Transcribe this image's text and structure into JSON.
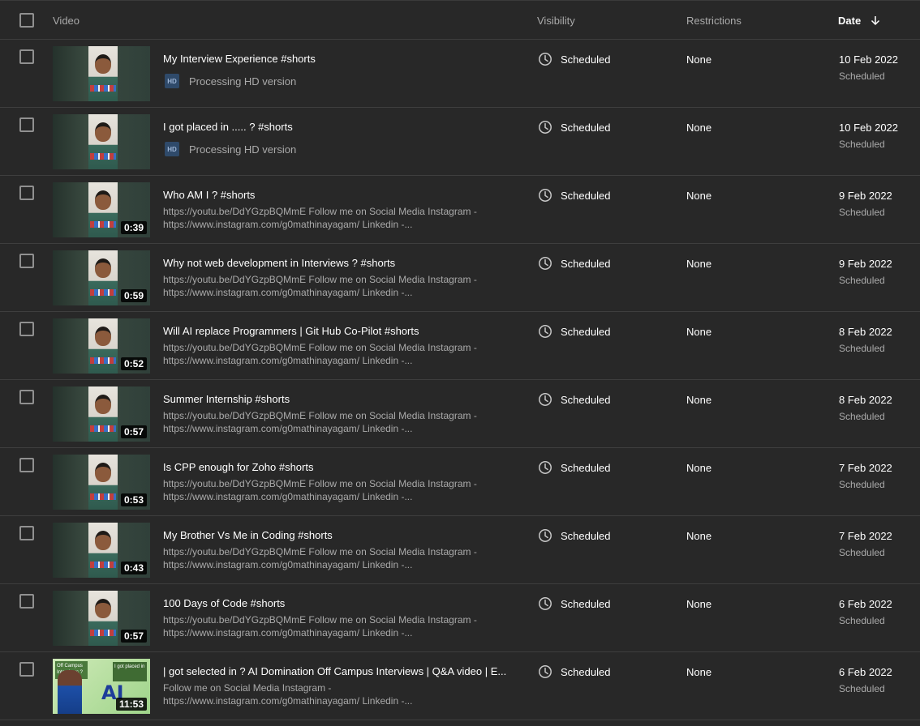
{
  "header": {
    "video": "Video",
    "visibility": "Visibility",
    "restrictions": "Restrictions",
    "date": "Date"
  },
  "rows": [
    {
      "title": "My Interview Experience #shorts",
      "processing": "Processing HD version",
      "duration": "",
      "visibility": "Scheduled",
      "restrictions": "None",
      "date": "10 Feb 2022",
      "date_status": "Scheduled"
    },
    {
      "title": "I got placed in ..... ? #shorts",
      "processing": "Processing HD version",
      "duration": "",
      "visibility": "Scheduled",
      "restrictions": "None",
      "date": "10 Feb 2022",
      "date_status": "Scheduled"
    },
    {
      "title": "Who AM I ? #shorts",
      "desc1": "https://youtu.be/DdYGzpBQMmE Follow me on Social Media Instagram -",
      "desc2": "https://www.instagram.com/g0mathinayagam/ Linkedin -...",
      "duration": "0:39",
      "visibility": "Scheduled",
      "restrictions": "None",
      "date": "9 Feb 2022",
      "date_status": "Scheduled"
    },
    {
      "title": "Why not web development in Interviews ? #shorts",
      "desc1": "https://youtu.be/DdYGzpBQMmE Follow me on Social Media Instagram -",
      "desc2": "https://www.instagram.com/g0mathinayagam/ Linkedin -...",
      "duration": "0:59",
      "visibility": "Scheduled",
      "restrictions": "None",
      "date": "9 Feb 2022",
      "date_status": "Scheduled"
    },
    {
      "title": "Will AI replace Programmers | Git Hub Co-Pilot #shorts",
      "desc1": "https://youtu.be/DdYGzpBQMmE Follow me on Social Media Instagram -",
      "desc2": "https://www.instagram.com/g0mathinayagam/ Linkedin -...",
      "duration": "0:52",
      "visibility": "Scheduled",
      "restrictions": "None",
      "date": "8 Feb 2022",
      "date_status": "Scheduled"
    },
    {
      "title": "Summer Internship #shorts",
      "desc1": "https://youtu.be/DdYGzpBQMmE Follow me on Social Media Instagram -",
      "desc2": "https://www.instagram.com/g0mathinayagam/ Linkedin -...",
      "duration": "0:57",
      "visibility": "Scheduled",
      "restrictions": "None",
      "date": "8 Feb 2022",
      "date_status": "Scheduled"
    },
    {
      "title": "Is CPP enough for Zoho #shorts",
      "desc1": "https://youtu.be/DdYGzpBQMmE Follow me on Social Media Instagram -",
      "desc2": "https://www.instagram.com/g0mathinayagam/ Linkedin -...",
      "duration": "0:53",
      "visibility": "Scheduled",
      "restrictions": "None",
      "date": "7 Feb 2022",
      "date_status": "Scheduled"
    },
    {
      "title": "My Brother Vs Me in Coding #shorts",
      "desc1": "https://youtu.be/DdYGzpBQMmE Follow me on Social Media Instagram -",
      "desc2": "https://www.instagram.com/g0mathinayagam/ Linkedin -...",
      "duration": "0:43",
      "visibility": "Scheduled",
      "restrictions": "None",
      "date": "7 Feb 2022",
      "date_status": "Scheduled"
    },
    {
      "title": "100 Days of Code #shorts",
      "desc1": "https://youtu.be/DdYGzpBQMmE Follow me on Social Media Instagram -",
      "desc2": "https://www.instagram.com/g0mathinayagam/ Linkedin -...",
      "duration": "0:57",
      "visibility": "Scheduled",
      "restrictions": "None",
      "date": "6 Feb 2022",
      "date_status": "Scheduled"
    },
    {
      "title": "| got selected in ? AI Domination Off Campus Interviews | Q&A video | E...",
      "desc1": "Follow me on Social Media Instagram -",
      "desc2": "https://www.instagram.com/g0mathinayagam/ Linkedin -...",
      "duration": "11:53",
      "visibility": "Scheduled",
      "restrictions": "None",
      "date": "6 Feb 2022",
      "date_status": "Scheduled",
      "thumb_style": "promo",
      "thumb_text": {
        "tag1": "Off Campus Interviews ?",
        "tag2": "I got placed in",
        "ai": "AI"
      }
    }
  ],
  "icons": {
    "processing": "hd-icon",
    "visibility": "clock-icon",
    "sort": "arrow-down-icon"
  },
  "hd_label": "HD",
  "colors": {
    "background": "#282828",
    "text_primary": "#ffffff",
    "text_secondary": "#aaaaaa",
    "divider": "#3e3e3e"
  }
}
